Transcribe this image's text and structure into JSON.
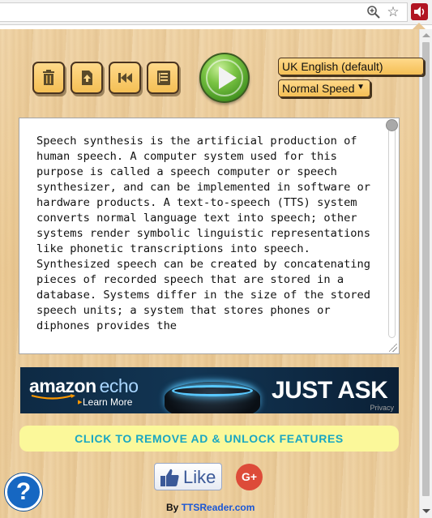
{
  "browser": {
    "icons": [
      "zoom-icon",
      "star-icon",
      "tts-extension-icon"
    ],
    "colors": {
      "extension": "#b11522"
    }
  },
  "toolbar": {
    "buttons": [
      {
        "name": "clear",
        "icon": "trash-icon"
      },
      {
        "name": "upload",
        "icon": "upload-file-icon"
      },
      {
        "name": "rewind",
        "icon": "rewind-icon"
      },
      {
        "name": "reader",
        "icon": "document-icon"
      }
    ],
    "play_icon": "play-icon"
  },
  "voice": {
    "selected": "UK English (default)"
  },
  "speed": {
    "selected": "Normal Speed",
    "caret": "▼"
  },
  "text": {
    "content": "Speech synthesis is the artificial production of human speech. A computer system used for this purpose is called a speech computer or speech synthesizer, and can be implemented in software or hardware products. A text-to-speech (TTS) system converts normal language text into speech; other systems render symbolic linguistic representations like phonetic transcriptions into speech. Synthesized speech can be created by concatenating pieces of recorded speech that are stored in a database. Systems differ in the size of the stored speech units; a system that stores phones or diphones provides the"
  },
  "ad": {
    "brand": "amazon",
    "product": "echo",
    "learn_more": "Learn More",
    "learn_more_arrow": "▸",
    "headline": "JUST ASK",
    "privacy": "Privacy"
  },
  "remove_ad": {
    "label": "CLICK TO REMOVE AD & UNLOCK FEATURES",
    "color": "#1aa7c2"
  },
  "social": {
    "like_label": "Like",
    "gplus_label": "G+"
  },
  "help": {
    "label": "?"
  },
  "byline": {
    "prefix": "By",
    "link": "TTSReader.com"
  }
}
